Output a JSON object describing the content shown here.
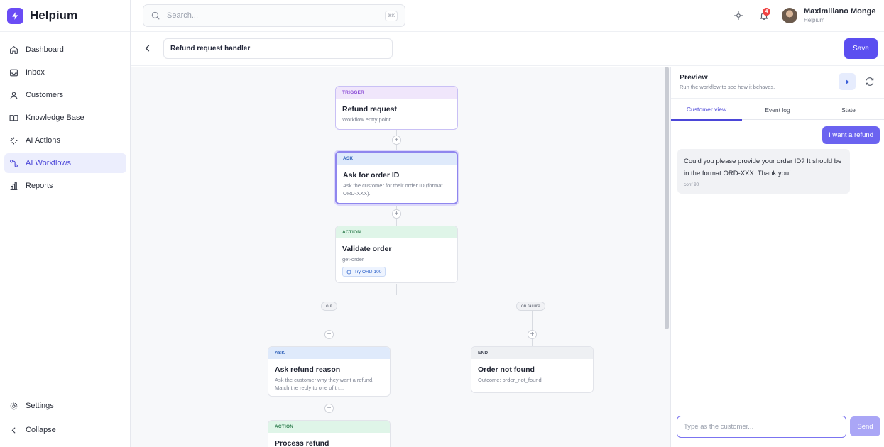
{
  "app": {
    "name": "Helpium"
  },
  "sidebar": {
    "items": [
      {
        "label": "Dashboard",
        "icon": "home-icon"
      },
      {
        "label": "Inbox",
        "icon": "inbox-icon"
      },
      {
        "label": "Customers",
        "icon": "users-icon"
      },
      {
        "label": "Knowledge Base",
        "icon": "book-icon"
      },
      {
        "label": "AI Actions",
        "icon": "sparkle-icon"
      },
      {
        "label": "AI Workflows",
        "icon": "workflow-icon",
        "active": true
      },
      {
        "label": "Reports",
        "icon": "chart-icon"
      }
    ],
    "bottom": [
      {
        "label": "Settings",
        "icon": "gear-icon"
      },
      {
        "label": "Collapse",
        "icon": "chevron-left-icon"
      }
    ]
  },
  "topbar": {
    "search_placeholder": "Search...",
    "shortcut": "⌘K",
    "notification_count": "4",
    "user_name": "Maximiliano Monge",
    "user_org": "Helpium"
  },
  "workflow": {
    "name": "Refund request handler",
    "save_label": "Save",
    "nodes": [
      {
        "type": "TRIGGER",
        "title": "Refund request",
        "desc": "Workflow entry point"
      },
      {
        "type": "ASK",
        "title": "Ask for order ID",
        "desc": "Ask the customer for their order ID (format ORD-XXX)."
      },
      {
        "type": "ACTION",
        "title": "Validate order",
        "desc": "get-order",
        "chip": "Try ORD-100"
      },
      {
        "type": "ASK",
        "title": "Ask refund reason",
        "desc": "Ask the customer why they want a refund. Match the reply to one of th..."
      },
      {
        "type": "END",
        "title": "Order not found",
        "desc": "Outcome: order_not_found"
      },
      {
        "type": "ACTION",
        "title": "Process refund",
        "desc": ""
      }
    ],
    "branches": {
      "out": "out",
      "failure": "on failure"
    },
    "plus": "+"
  },
  "preview": {
    "title": "Preview",
    "subtitle": "Run the workflow to see how it behaves.",
    "tabs": [
      "Customer view",
      "Event log",
      "State"
    ],
    "active_tab": "Customer view",
    "messages": {
      "user": "I want a refund",
      "bot": "Could you please provide your order ID? It should be in the format ORD-XXX. Thank you!",
      "bot_meta": "conf 90"
    },
    "input_placeholder": "Type as the customer...",
    "send_label": "Send"
  },
  "colors": {
    "accent": "#5b4ef0",
    "active_nav_bg": "#eceefd",
    "badge": "#ef4444"
  }
}
